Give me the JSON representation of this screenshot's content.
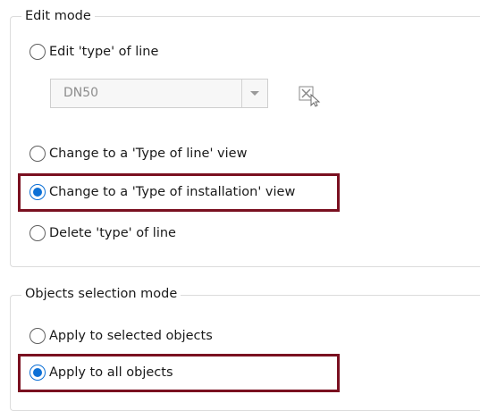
{
  "edit_mode": {
    "legend": "Edit mode",
    "options": [
      {
        "label": "Edit 'type' of line",
        "checked": false
      },
      {
        "label": "Change to a 'Type of line' view",
        "checked": false
      },
      {
        "label": "Change to a 'Type of installation' view",
        "checked": true
      },
      {
        "label": "Delete 'type' of line",
        "checked": false
      }
    ],
    "line_type_select": {
      "value": "DN50",
      "enabled": false
    },
    "pick_icon": "select-from-drawing-icon"
  },
  "objects_selection_mode": {
    "legend": "Objects selection mode",
    "options": [
      {
        "label": "Apply to selected objects",
        "checked": false
      },
      {
        "label": "Apply to all objects",
        "checked": true
      }
    ]
  },
  "colors": {
    "radio_checked": "#0c70d6",
    "highlight_border": "#7a1020",
    "group_border": "#dcdcdc",
    "disabled_text": "#8d8d8d"
  }
}
